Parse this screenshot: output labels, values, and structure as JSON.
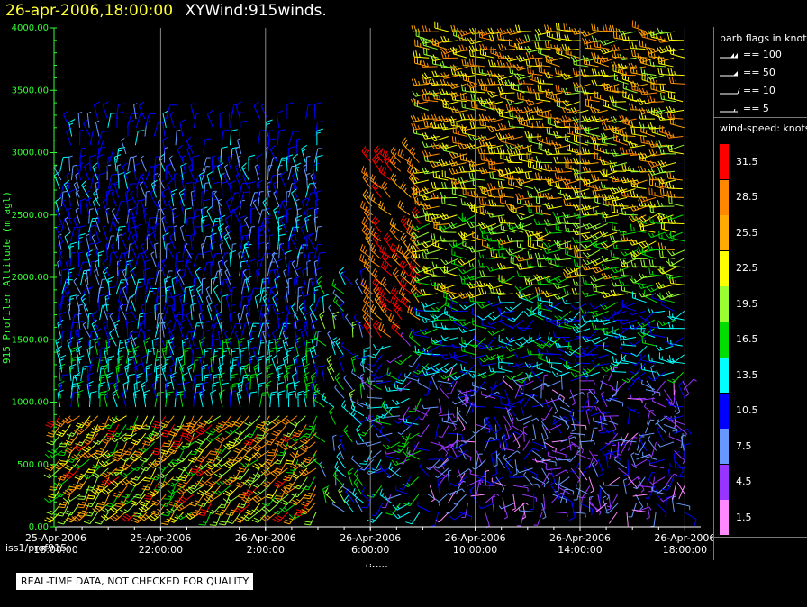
{
  "header": {
    "date_time": "26-apr-2006,18:00:00",
    "product": "XYWind:915winds."
  },
  "disclaimer": "REAL-TIME DATA, NOT CHECKED FOR QUALITY",
  "station": "iss1/prof915l",
  "legend": {
    "flags_title": "barb flags in knots",
    "flags": [
      "== 100",
      "== 50",
      "== 10",
      "== 5"
    ],
    "speed_title": "wind-speed: knots",
    "speed_levels": [
      "31.5",
      "28.5",
      "25.5",
      "22.5",
      "19.5",
      "16.5",
      "13.5",
      "10.5",
      "7.5",
      "4.5",
      "1.5"
    ],
    "speed_colors": [
      "#ff0000",
      "#ff8800",
      "#ffaa00",
      "#ffff00",
      "#99ff33",
      "#00dd00",
      "#00ffff",
      "#0000ff",
      "#6699ff",
      "#9933ff",
      "#ff88ff"
    ]
  },
  "chart_data": {
    "type": "scatter",
    "mark": "wind barbs",
    "title": "",
    "xlabel": "time",
    "ylabel": "915 Profiler Altitude (m agl)",
    "ylim": [
      0,
      4000
    ],
    "yticks": [
      "0.00",
      "500.00",
      "1000.00",
      "1500.00",
      "2000.00",
      "2500.00",
      "3000.00",
      "3500.00",
      "4000.00"
    ],
    "xtick_labels": [
      [
        "25-Apr-2006",
        "18:00:00"
      ],
      [
        "25-Apr-2006",
        "22:00:00"
      ],
      [
        "26-Apr-2006",
        "2:00:00"
      ],
      [
        "26-Apr-2006",
        "6:00:00"
      ],
      [
        "26-Apr-2006",
        "10:00:00"
      ],
      [
        "26-Apr-2006",
        "14:00:00"
      ],
      [
        "26-Apr-2006",
        "18:00:00"
      ]
    ],
    "grid": "vertical at major ticks",
    "speed_unit": "knots",
    "approx_wind_regimes": [
      {
        "time": "25-Apr 18:00 – 26-Apr 04:00",
        "altitude": "0–1000 m agl",
        "speed_knots": "16–31",
        "direction": "southerly/southwesterly"
      },
      {
        "time": "25-Apr 18:00 – 26-Apr 04:00",
        "altitude": "1000–3300 m agl",
        "speed_knots": "7–13",
        "direction": "northerly"
      },
      {
        "time": "26-Apr 06:00 – 26-Apr 07:30",
        "altitude": "1500–2700 m agl",
        "speed_knots": "28–31",
        "direction": "northwesterly"
      },
      {
        "time": "26-Apr 08:00 – 26-Apr 18:00",
        "altitude": "2500–4000 m agl",
        "speed_knots": "19–28",
        "direction": "westerly"
      },
      {
        "time": "26-Apr 06:00 – 26-Apr 18:00",
        "altitude": "0–1200 m agl",
        "speed_knots": "1.5–10",
        "direction": "variable"
      }
    ]
  }
}
